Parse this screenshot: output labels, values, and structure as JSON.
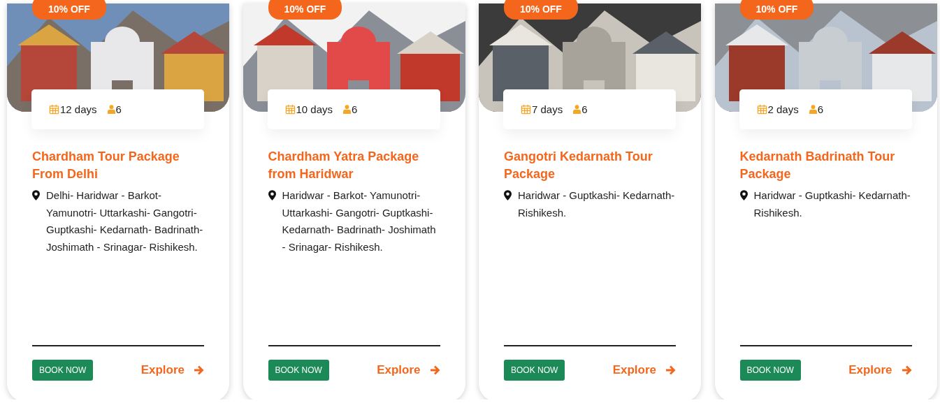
{
  "cards": [
    {
      "discount": "10% OFF",
      "duration": "12 days",
      "people": "6",
      "title": "Chardham Tour Package From Delhi",
      "route": "Delhi- Haridwar - Barkot- Yamunotri- Uttarkashi- Gangotri- Guptkashi- Kedarnath- Badrinath- Joshimath - Srinagar- Rishikesh.",
      "book": "BOOK NOW",
      "explore": "Explore"
    },
    {
      "discount": "10% OFF",
      "duration": "10 days",
      "people": "6",
      "title": "Chardham Yatra Package from Haridwar",
      "route": "Haridwar - Barkot- Yamunotri- Uttarkashi- Gangotri- Guptkashi- Kedarnath- Badrinath- Joshimath - Srinagar- Rishikesh.",
      "book": "BOOK NOW",
      "explore": "Explore"
    },
    {
      "discount": "10% OFF",
      "duration": "7 days",
      "people": "6",
      "title": "Gangotri Kedarnath Tour Package",
      "route": "Haridwar - Guptkashi- Kedarnath- Rishikesh.",
      "book": "BOOK NOW",
      "explore": "Explore"
    },
    {
      "discount": "10% OFF",
      "duration": "2 days",
      "people": "6",
      "title": "Kedarnath Badrinath Tour Package",
      "route": "Haridwar - Guptkashi- Kedarnath- Rishikesh.",
      "book": "BOOK NOW",
      "explore": "Explore"
    }
  ]
}
